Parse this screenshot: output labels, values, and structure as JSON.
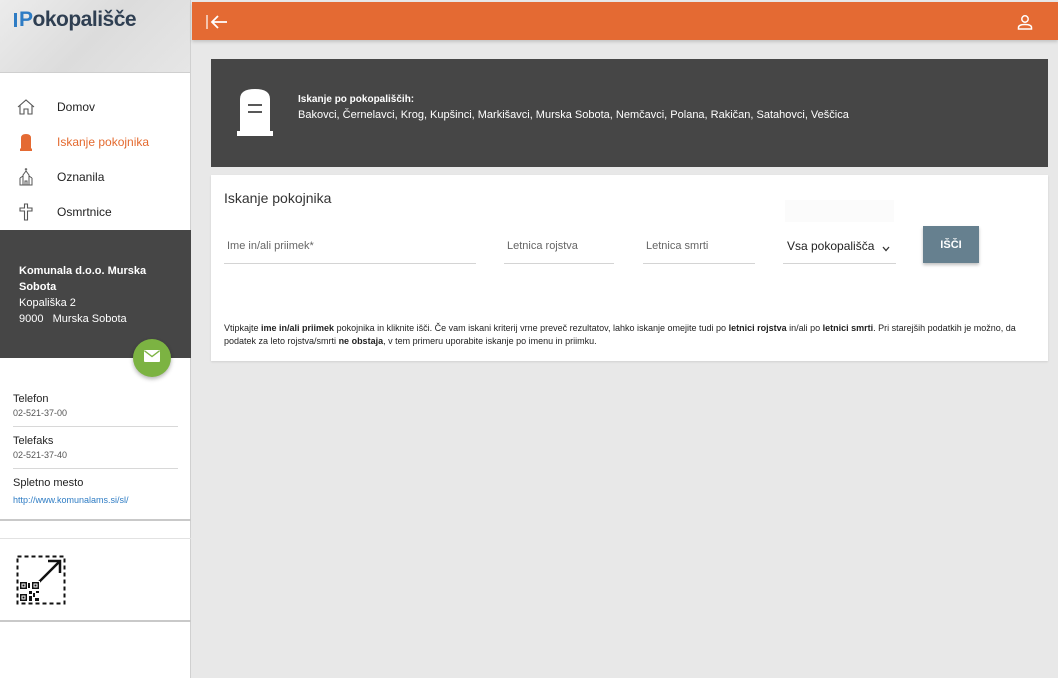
{
  "logo": {
    "text_prefix": "P",
    "text_rest": "okopališče"
  },
  "sidebar": {
    "items": [
      {
        "label": "Domov",
        "icon": "home-icon",
        "active": false
      },
      {
        "label": "Iskanje pokojnika",
        "icon": "tombstone-icon",
        "active": true
      },
      {
        "label": "Oznanila",
        "icon": "chapel-icon",
        "active": false
      },
      {
        "label": "Osmrtnice",
        "icon": "cross-icon",
        "active": false
      }
    ],
    "company": {
      "name": "Komunala d.o.o. Murska Sobota",
      "street": "Kopališka 2",
      "city": "9000   Murska Sobota"
    },
    "contacts": [
      {
        "label": "Telefon",
        "value": "02-521-37-00"
      },
      {
        "label": "Telefaks",
        "value": "02-521-37-40"
      },
      {
        "label": "Spletno mesto",
        "value": "http://www.komunalams.si/sl/"
      }
    ]
  },
  "colors": {
    "accent": "#e46a33",
    "dark_panel": "#464646",
    "mail_button": "#7cb342",
    "search_button": "#66808f",
    "link": "#2e7cc4"
  },
  "banner": {
    "title": "Iskanje po pokopališčih:",
    "cemeteries": "Bakovci, Černelavci, Krog, Kupšinci, Markišavci, Murska Sobota, Nemčavci, Polana, Rakičan, Satahovci, Veščica"
  },
  "search": {
    "title": "Iskanje pokojnika",
    "name_placeholder": "Ime in/ali priimek*",
    "birth_placeholder": "Letnica rojstva",
    "death_placeholder": "Letnica smrti",
    "cemetery_selected": "Vsa pokopališča",
    "button": "IŠČI",
    "hint": {
      "p1": "Vtipkajte ",
      "b1": "ime in/ali priimek",
      "p2": " pokojnika in kliknite išči. Če vam iskani kriterij vrne preveč rezultatov, lahko iskanje omejite tudi po ",
      "b2": "letnici rojstva",
      "p3": " in/ali po ",
      "b3": "letnici smrti",
      "p4": ". Pri starejših podatkih je možno, da podatek za leto rojstva/smrti ",
      "b4": "ne obstaja",
      "p5": ", v tem primeru uporabite iskanje po imenu in priimku."
    }
  }
}
